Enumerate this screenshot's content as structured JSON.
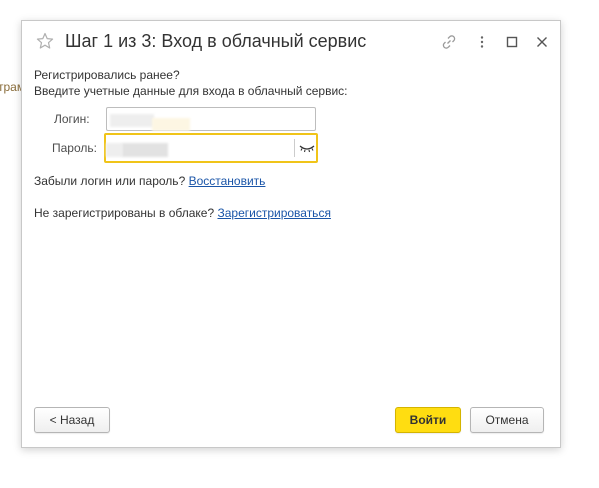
{
  "background": {
    "fragment_text": "трам"
  },
  "dialog": {
    "title": "Шаг 1 из 3: Вход в облачный сервис",
    "icons": {
      "favorite": "star-icon",
      "link": "link-icon",
      "more": "more-vertical-icon",
      "maximize": "maximize-icon",
      "close": "close-icon"
    }
  },
  "content": {
    "registered_question": "Регистрировались ранее?",
    "instruction": "Введите учетные данные для входа в облачный сервис:",
    "login": {
      "label": "Логин:",
      "value": ""
    },
    "password": {
      "label": "Пароль:",
      "value": "",
      "toggle_icon": "eye-closed-icon"
    },
    "forgot": {
      "text": "Забыли логин или пароль?",
      "link": "Восстановить"
    },
    "not_registered": {
      "text": "Не зарегистрированы в облаке?",
      "link": "Зарегистрироваться"
    }
  },
  "footer": {
    "back_label": "< Назад",
    "login_label": "Войти",
    "cancel_label": "Отмена"
  },
  "colors": {
    "primary_button": "#ffdd11",
    "focus_border": "#f0c419",
    "link": "#1a55a8"
  }
}
